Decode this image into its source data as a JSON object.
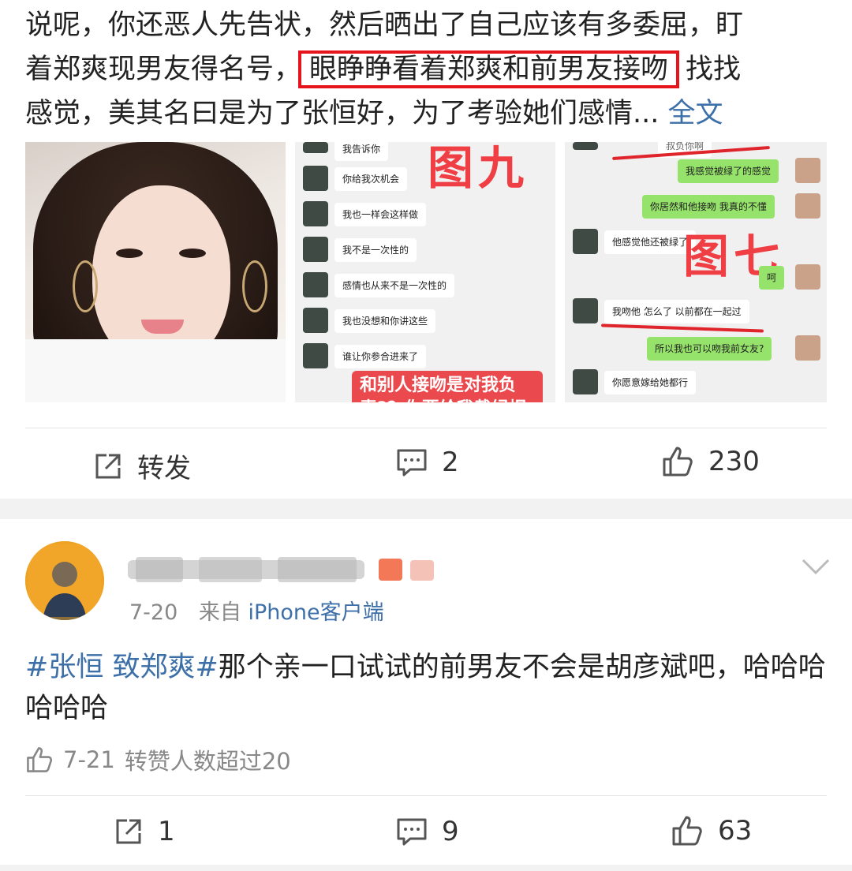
{
  "post": {
    "line1": "说呢，你还恶人先告状，然后晒出了自己应该有多委屈，盯",
    "line2_before": "着郑爽现男友得名号，",
    "line2_highlight": "眼睁睁看着郑爽和前男友接吻",
    "line2_after": "找找",
    "line3": "感觉，美其名曰是为了张恒好，为了考验她们感情...",
    "full_text_link": "全文"
  },
  "image2": {
    "stamp": "图九",
    "messages": [
      "我告诉你",
      "你给我次机会",
      "我也一样会这样做",
      "我不是一次性的",
      "感情也从来不是一次性的",
      "我也没想和你讲这些",
      "谁让你参合进来了"
    ],
    "caption": "和别人接吻是对我负责?？你要给我戴绿帽"
  },
  "image3": {
    "stamp": "图七",
    "messages": [
      {
        "text": "叔负你啊",
        "side": "right"
      },
      {
        "text": "我感觉被绿了的感觉",
        "side": "right"
      },
      {
        "text": "你居然和他接吻 我真的不懂",
        "side": "right"
      },
      {
        "text": "他感觉他还被绿了",
        "side": "left"
      },
      {
        "text": "呵",
        "side": "right"
      },
      {
        "text": "我吻他 怎么了 以前都在一起过",
        "side": "left"
      },
      {
        "text": "所以我也可以吻我前女友?",
        "side": "right"
      },
      {
        "text": "你愿意嫁给她都行",
        "side": "left"
      }
    ]
  },
  "post_actions": {
    "repost_label": "转发",
    "comment_count": "2",
    "like_count": "230"
  },
  "comment": {
    "date": "7-20",
    "source_prefix": "来自",
    "source": "iPhone客户端",
    "hashtag": "#张恒 致郑爽#",
    "text": "那个亲一口试试的前男友不会是胡彦斌吧，哈哈哈哈哈哈",
    "like_date": "7-21",
    "like_text": "转赞人数超过20",
    "repost_count": "1",
    "comment_count": "9",
    "like_count": "63"
  },
  "colors": {
    "link": "#3d6fa8",
    "highlight_border": "#e8141c",
    "text": "#222222",
    "muted": "#888888"
  }
}
